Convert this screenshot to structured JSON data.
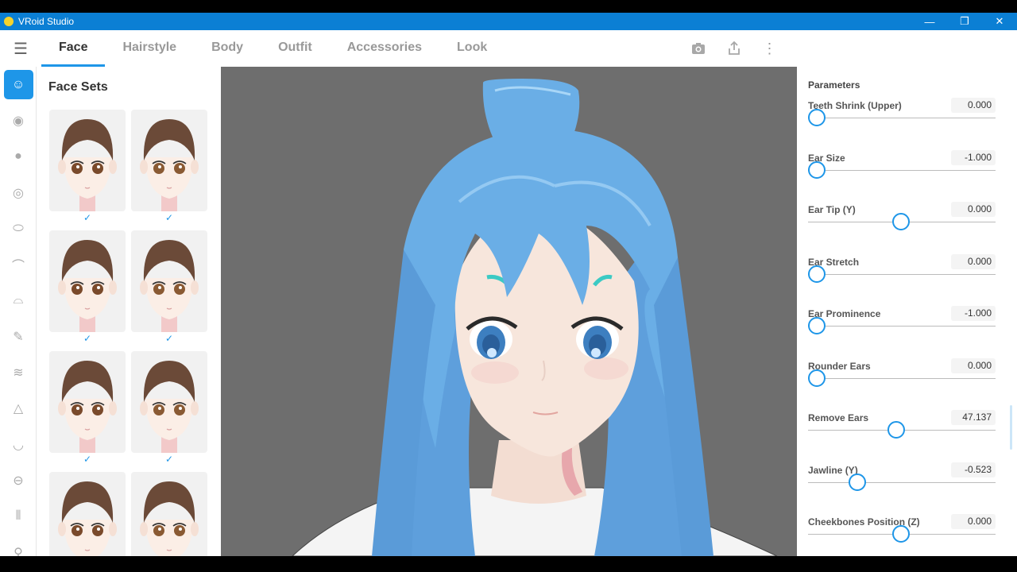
{
  "window": {
    "title": "VRoid Studio",
    "minimize": "—",
    "restore": "❐",
    "close": "✕"
  },
  "tabs": [
    "Face",
    "Hairstyle",
    "Body",
    "Outfit",
    "Accessories",
    "Look"
  ],
  "active_tab": "Face",
  "left_icons": [
    "face-icon",
    "eye-icon",
    "iris-icon",
    "eye-outline-icon",
    "eye-white-icon",
    "eyebrow-icon",
    "eyelash-icon",
    "pen-icon",
    "eyeliner-icon",
    "nose-icon",
    "mouth-icon",
    "lips-icon",
    "ear-icon",
    "hair-pin-icon"
  ],
  "face_sets": {
    "title": "Face Sets",
    "items": [
      {
        "check": "✓"
      },
      {
        "check": "✓"
      },
      {
        "check": "✓"
      },
      {
        "check": "✓"
      },
      {
        "check": "✓"
      },
      {
        "check": "✓"
      },
      {
        "check": ""
      },
      {
        "check": ""
      }
    ]
  },
  "parameters": {
    "title": "Parameters",
    "items": [
      {
        "label": "Teeth Shrink (Upper)",
        "value": "0.000",
        "level": 0.0
      },
      {
        "label": "Ear Size",
        "value": "-1.000",
        "level": 0.0
      },
      {
        "label": "Ear Tip (Y)",
        "value": "0.000",
        "level": 0.5
      },
      {
        "label": "Ear Stretch",
        "value": "0.000",
        "level": 0.0
      },
      {
        "label": "Ear Prominence",
        "value": "-1.000",
        "level": 0.0
      },
      {
        "label": "Rounder Ears",
        "value": "0.000",
        "level": 0.0
      },
      {
        "label": "Remove Ears",
        "value": "47.137",
        "level": 0.47
      },
      {
        "label": "Jawline (Y)",
        "value": "-0.523",
        "level": 0.24
      },
      {
        "label": "Cheekbones Position (Z)",
        "value": "0.000",
        "level": 0.5
      }
    ]
  },
  "colors": {
    "accent": "#1e96e8",
    "titlebar": "#0b7fd4",
    "hair": "#6aaee6",
    "viewport": "#6e6e6e"
  }
}
